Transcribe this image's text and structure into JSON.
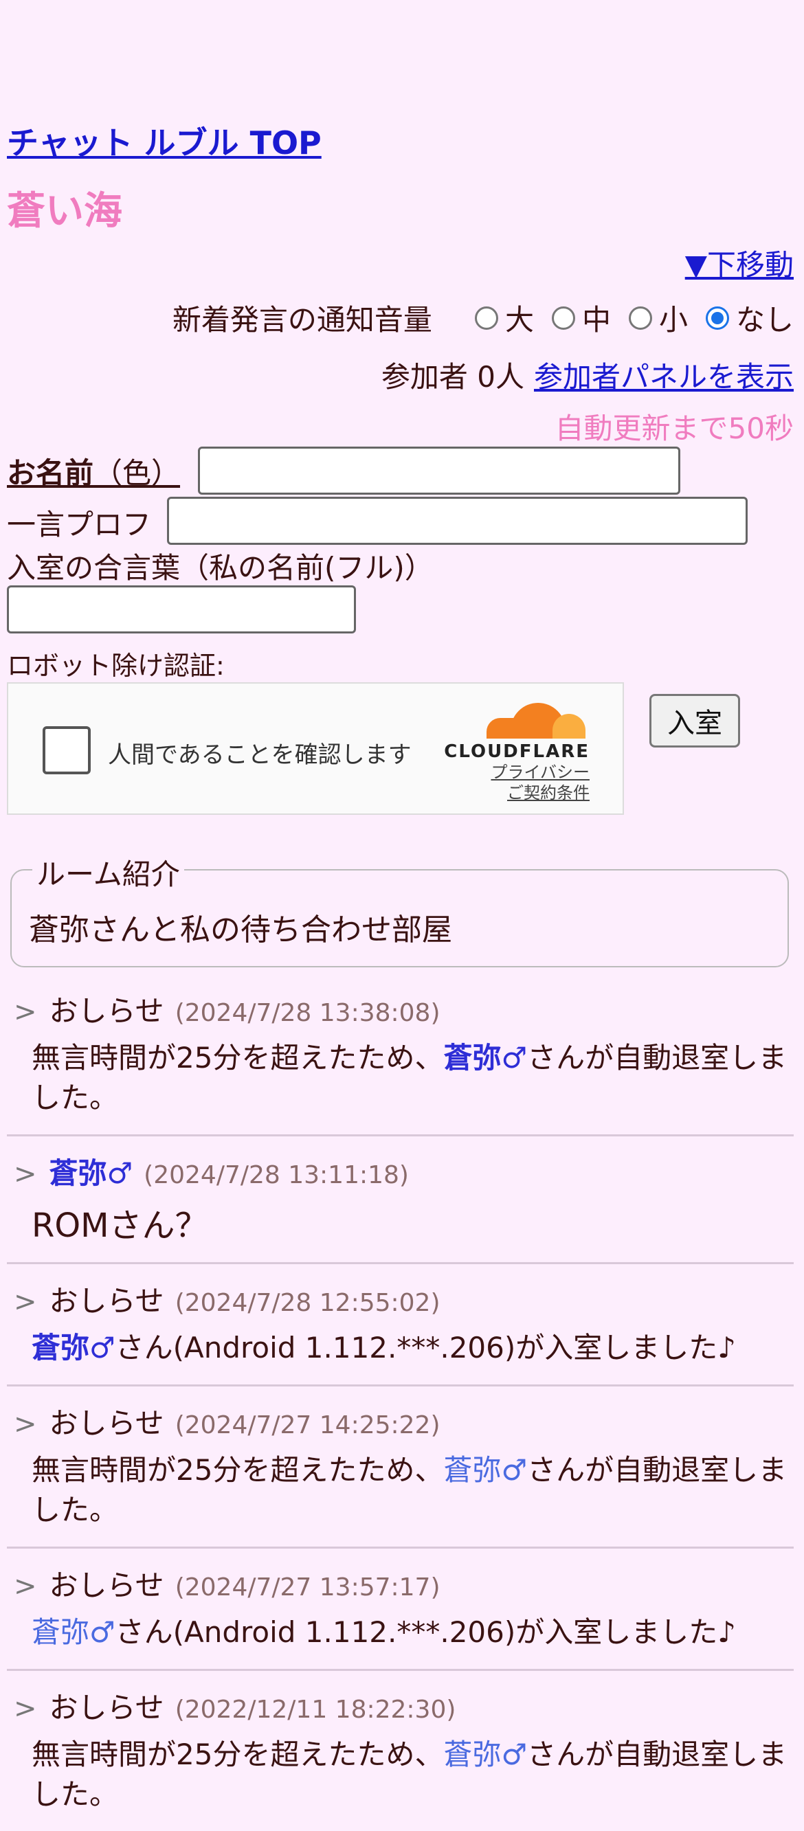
{
  "header": {
    "top_link": "チャット ルブル TOP",
    "room_title": "蒼い海",
    "down_link": "▼下移動"
  },
  "sound": {
    "label": "新着発言の通知音量",
    "options": [
      "大",
      "中",
      "小",
      "なし"
    ],
    "selected": "なし"
  },
  "participants": {
    "label": "参加者 0人",
    "panel_link": "参加者パネルを表示"
  },
  "auto_refresh": "自動更新まで50秒",
  "form": {
    "name_label_bold": "お名前",
    "name_label_rest": "（色）",
    "name_value": "",
    "prof_label": "一言プロフ",
    "prof_value": "",
    "pass_label": "入室の合言葉（私の名前(フル)）",
    "pass_value": "",
    "robot_label": "ロボット除け認証:",
    "captcha_text": "人間であることを確認します",
    "captcha_brand": "CLOUDFLARE",
    "captcha_privacy": "プライバシー",
    "captcha_terms": "ご契約条件",
    "enter_button": "入室"
  },
  "intro": {
    "legend": "ルーム紹介",
    "text": "蒼弥さんと私の待ち合わせ部屋"
  },
  "messages": [
    {
      "gt": ">",
      "who": "おしらせ",
      "time": "(2024/7/28 13:38:08)",
      "pre": "無言時間が25分を超えたため、",
      "name": "蒼弥♂",
      "post": "さんが自動退室しました。"
    },
    {
      "gt": ">",
      "who": "蒼弥♂",
      "time": "(2024/7/28 13:11:18)",
      "text": "ROMさん？"
    },
    {
      "gt": ">",
      "who": "おしらせ",
      "time": "(2024/7/28 12:55:02)",
      "name": "蒼弥♂",
      "post": "さん(Android 1.112.***.206)が入室しました♪"
    },
    {
      "gt": ">",
      "who": "おしらせ",
      "time": "(2024/7/27 14:25:22)",
      "pre": "無言時間が25分を超えたため、",
      "name": "蒼弥♂",
      "post": "さんが自動退室しました。"
    },
    {
      "gt": ">",
      "who": "おしらせ",
      "time": "(2024/7/27 13:57:17)",
      "name": "蒼弥♂",
      "post": "さん(Android 1.112.***.206)が入室しました♪"
    },
    {
      "gt": ">",
      "who": "おしらせ",
      "time": "(2022/12/11 18:22:30)",
      "pre": "無言時間が25分を超えたため、",
      "name": "蒼弥♂",
      "post": "さんが自動退室しました。"
    }
  ]
}
